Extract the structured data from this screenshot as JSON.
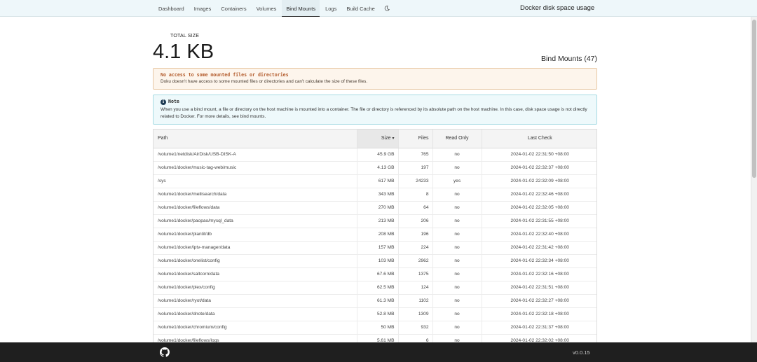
{
  "nav": {
    "items": [
      "Dashboard",
      "Images",
      "Containers",
      "Volumes",
      "Bind Mounts",
      "Logs",
      "Build Cache"
    ],
    "active": "Bind Mounts",
    "theme_icon": "moon-icon"
  },
  "app_title": "Docker disk space usage",
  "summary": {
    "total_label": "TOTAL SIZE",
    "total_value": "4.1 KB"
  },
  "section_title": "Bind Mounts (47)",
  "warning": {
    "title": "No access to some mounted files or directories",
    "text": "Doku doesn't have access to some mounted files or directories and can't calculate the size of these files."
  },
  "note": {
    "icon": "info-icon",
    "title": "Note",
    "text": "When you use a bind mount, a file or directory on the host machine is mounted into a container. The file or directory is referenced by its absolute path on the host machine. In this case, disk space usage is not directly related to Docker. For more details, see bind mounts."
  },
  "table": {
    "headers": {
      "path": "Path",
      "size": "Size",
      "files": "Files",
      "read_only": "Read Only",
      "last_check": "Last Check"
    },
    "sort_indicator": "▾",
    "rows": [
      {
        "path": "/volume1/netdisk/AirDisk/USB-DISK-A",
        "size": "45.9 GB",
        "files": "765",
        "read_only": "no",
        "last_check": "2024-01-02 22:31:50 +08:00"
      },
      {
        "path": "/volume1/docker/music-tag-web/music",
        "size": "4.13 GB",
        "files": "197",
        "read_only": "no",
        "last_check": "2024-01-02 22:32:37 +08:00"
      },
      {
        "path": "/sys",
        "size": "617 MB",
        "files": "24233",
        "read_only": "yes",
        "last_check": "2024-01-02 22:32:09 +08:00"
      },
      {
        "path": "/volume1/docker/meilisearch/data",
        "size": "343 MB",
        "files": "8",
        "read_only": "no",
        "last_check": "2024-01-02 22:32:46 +08:00"
      },
      {
        "path": "/volume1/docker/fileflows/data",
        "size": "270 MB",
        "files": "64",
        "read_only": "no",
        "last_check": "2024-01-02 22:32:05 +08:00"
      },
      {
        "path": "/volume1/docker/paopao/mysql_data",
        "size": "213 MB",
        "files": "206",
        "read_only": "no",
        "last_check": "2024-01-02 22:31:55 +08:00"
      },
      {
        "path": "/volume1/docker/plantit/db",
        "size": "208 MB",
        "files": "196",
        "read_only": "no",
        "last_check": "2024-01-02 22:32:40 +08:00"
      },
      {
        "path": "/volume1/docker/iptv-manager/data",
        "size": "157 MB",
        "files": "224",
        "read_only": "no",
        "last_check": "2024-01-02 22:31:42 +08:00"
      },
      {
        "path": "/volume1/docker/onelist/config",
        "size": "103 MB",
        "files": "2962",
        "read_only": "no",
        "last_check": "2024-01-02 22:32:34 +08:00"
      },
      {
        "path": "/volume1/docker/saltcorn/data",
        "size": "67.6 MB",
        "files": "1375",
        "read_only": "no",
        "last_check": "2024-01-02 22:32:16 +08:00"
      },
      {
        "path": "/volume1/docker/plex/config",
        "size": "62.5 MB",
        "files": "124",
        "read_only": "no",
        "last_check": "2024-01-02 22:31:51 +08:00"
      },
      {
        "path": "/volume1/docker/ryot/data",
        "size": "61.3 MB",
        "files": "1102",
        "read_only": "no",
        "last_check": "2024-01-02 22:32:27 +08:00"
      },
      {
        "path": "/volume1/docker/dnote/data",
        "size": "52.8 MB",
        "files": "1309",
        "read_only": "no",
        "last_check": "2024-01-02 22:32:18 +08:00"
      },
      {
        "path": "/volume1/docker/chromium/config",
        "size": "50 MB",
        "files": "932",
        "read_only": "no",
        "last_check": "2024-01-02 22:31:37 +08:00"
      },
      {
        "path": "/volume1/docker/fileflows/logs",
        "size": "5.61 MB",
        "files": "6",
        "read_only": "no",
        "last_check": "2024-01-02 22:32:02 +08:00"
      }
    ]
  },
  "footer": {
    "icon": "github-icon",
    "version": "v0.0.15"
  }
}
